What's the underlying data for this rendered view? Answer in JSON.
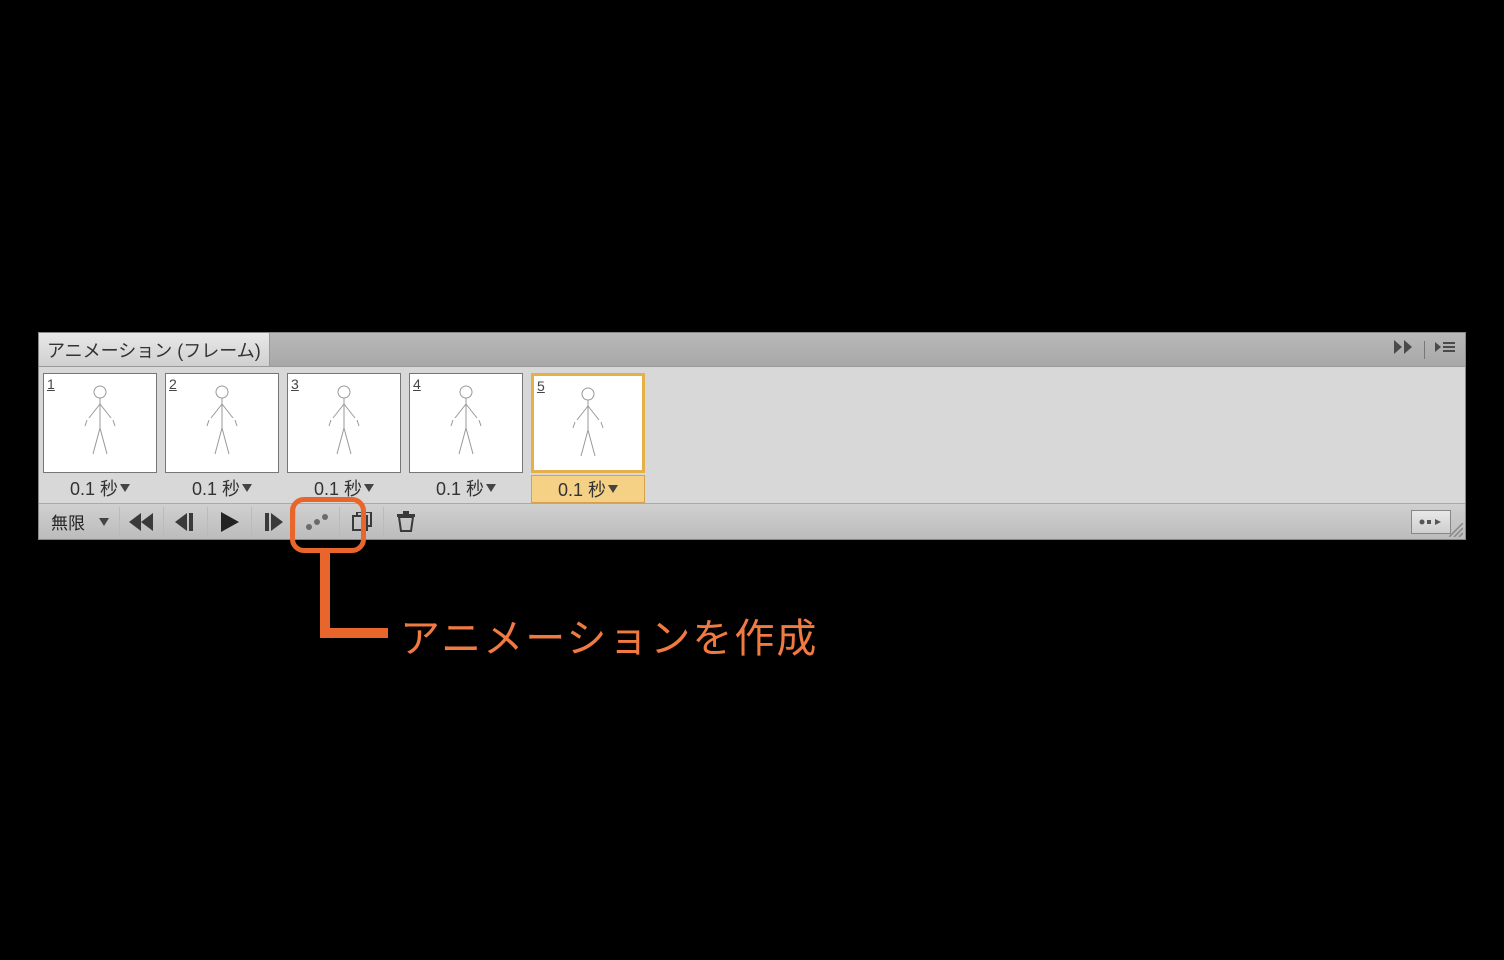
{
  "panel": {
    "title": "アニメーション (フレーム)"
  },
  "frames": [
    {
      "num": "1",
      "delay": "0.1 秒",
      "selected": false
    },
    {
      "num": "2",
      "delay": "0.1 秒",
      "selected": false
    },
    {
      "num": "3",
      "delay": "0.1 秒",
      "selected": false
    },
    {
      "num": "4",
      "delay": "0.1 秒",
      "selected": false
    },
    {
      "num": "5",
      "delay": "0.1 秒",
      "selected": true
    }
  ],
  "controls": {
    "loop_label": "無限"
  },
  "callout": {
    "label": "アニメーションを作成"
  },
  "colors": {
    "accent": "#e8662c"
  }
}
